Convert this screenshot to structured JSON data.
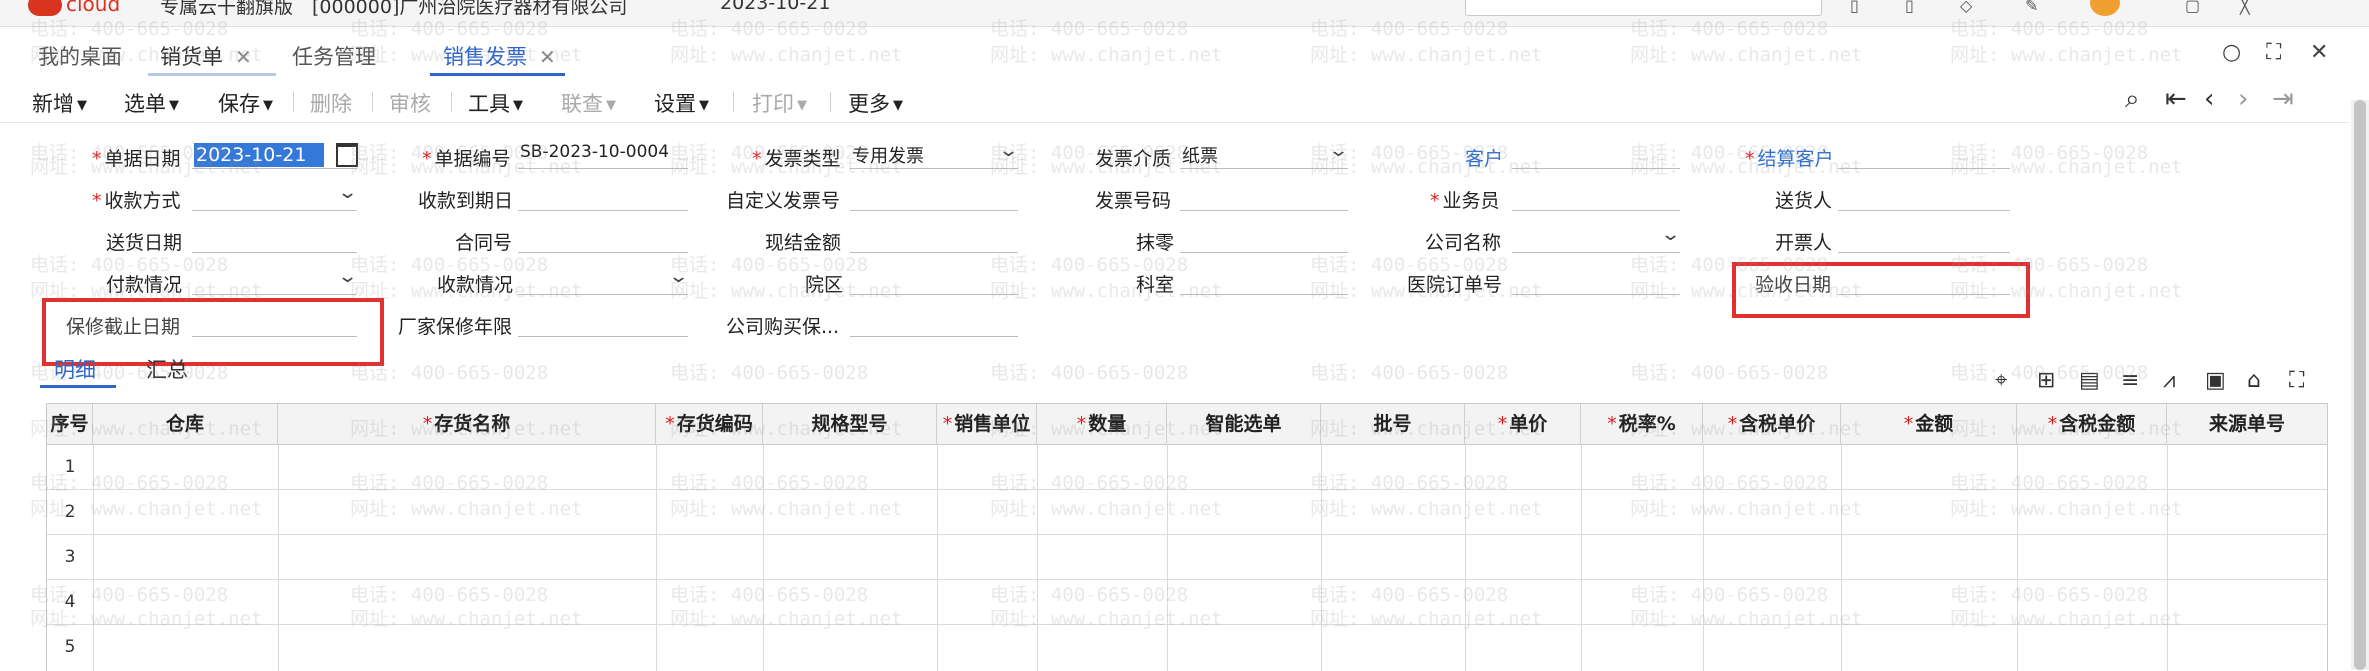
{
  "topbar": {
    "logo_text": "cloud",
    "app_title": "专属云干翻旗版　[000000]广州治院医疗器材有限公司",
    "date_text": "2023-10-21"
  },
  "tabs": [
    {
      "label": "我的桌面"
    },
    {
      "label": "销货单",
      "close": "✕"
    },
    {
      "label": "任务管理"
    },
    {
      "label": "销售发票",
      "close": "✕"
    }
  ],
  "toolbar": {
    "items": [
      {
        "label": "新增",
        "caret": true,
        "disabled": false
      },
      {
        "label": "选单",
        "caret": true,
        "disabled": false
      },
      {
        "label": "保存",
        "caret": true,
        "disabled": false
      },
      {
        "label": "删除",
        "caret": false,
        "disabled": true
      },
      {
        "label": "审核",
        "caret": false,
        "disabled": true
      },
      {
        "label": "工具",
        "caret": true,
        "disabled": false
      },
      {
        "label": "联查",
        "caret": true,
        "disabled": true
      },
      {
        "label": "设置",
        "caret": true,
        "disabled": false
      },
      {
        "label": "打印",
        "caret": true,
        "disabled": true
      },
      {
        "label": "更多",
        "caret": true,
        "disabled": false
      }
    ]
  },
  "form": {
    "bill_date": {
      "label": "单据日期",
      "value": "2023-10-21",
      "required": true
    },
    "bill_no": {
      "label": "单据编号",
      "value": "SB-2023-10-0004",
      "required": true
    },
    "invoice_type": {
      "label": "发票类型",
      "value": "专用发票",
      "required": true
    },
    "invoice_medium": {
      "label": "发票介质",
      "value": "纸票"
    },
    "customer": {
      "label": "客户"
    },
    "settle_customer": {
      "label": "结算客户",
      "required": true
    },
    "pay_method": {
      "label": "收款方式",
      "required": true
    },
    "due_date": {
      "label": "收款到期日"
    },
    "custom_invoice_no": {
      "label": "自定义发票号"
    },
    "invoice_no": {
      "label": "发票号码"
    },
    "salesman": {
      "label": "业务员",
      "required": true
    },
    "deliverer": {
      "label": "送货人"
    },
    "delivery_date": {
      "label": "送货日期"
    },
    "contract_no": {
      "label": "合同号"
    },
    "cash_amount": {
      "label": "现结金额"
    },
    "rounding": {
      "label": "抹零"
    },
    "company_name": {
      "label": "公司名称"
    },
    "invoicer": {
      "label": "开票人"
    },
    "payment_status": {
      "label": "付款情况"
    },
    "collection_status": {
      "label": "收款情况"
    },
    "hospital_area": {
      "label": "院区"
    },
    "department": {
      "label": "科室"
    },
    "hospital_order_no": {
      "label": "医院订单号"
    },
    "accept_date": {
      "label": "验收日期"
    },
    "warranty_end": {
      "label": "保修截止日期"
    },
    "factory_warranty": {
      "label": "厂家保修年限"
    },
    "company_purchase": {
      "label": "公司购买保..."
    }
  },
  "subtabs": [
    {
      "label": "明细"
    },
    {
      "label": "汇总"
    }
  ],
  "grid": {
    "columns": [
      {
        "label": "序号",
        "required": false
      },
      {
        "label": "仓库",
        "required": false
      },
      {
        "label": "存货名称",
        "required": true
      },
      {
        "label": "存货编码",
        "required": true
      },
      {
        "label": "规格型号",
        "required": false
      },
      {
        "label": "销售单位",
        "required": true
      },
      {
        "label": "数量",
        "required": true
      },
      {
        "label": "智能选单",
        "required": false
      },
      {
        "label": "批号",
        "required": false
      },
      {
        "label": "单价",
        "required": true
      },
      {
        "label": "税率%",
        "required": true
      },
      {
        "label": "含税单价",
        "required": true
      },
      {
        "label": "金额",
        "required": true
      },
      {
        "label": "含税金额",
        "required": true
      },
      {
        "label": "来源单号",
        "required": false
      }
    ],
    "rows": [
      "1",
      "2",
      "3",
      "4",
      "5"
    ]
  },
  "watermark": {
    "phone": "电话: 400-665-0028",
    "site": "网址: www.chanjet.net"
  },
  "colors": {
    "accent": "#2f66c9",
    "required": "#e02020",
    "highlight_box": "#e03030",
    "date_selection": "#3478d8"
  }
}
